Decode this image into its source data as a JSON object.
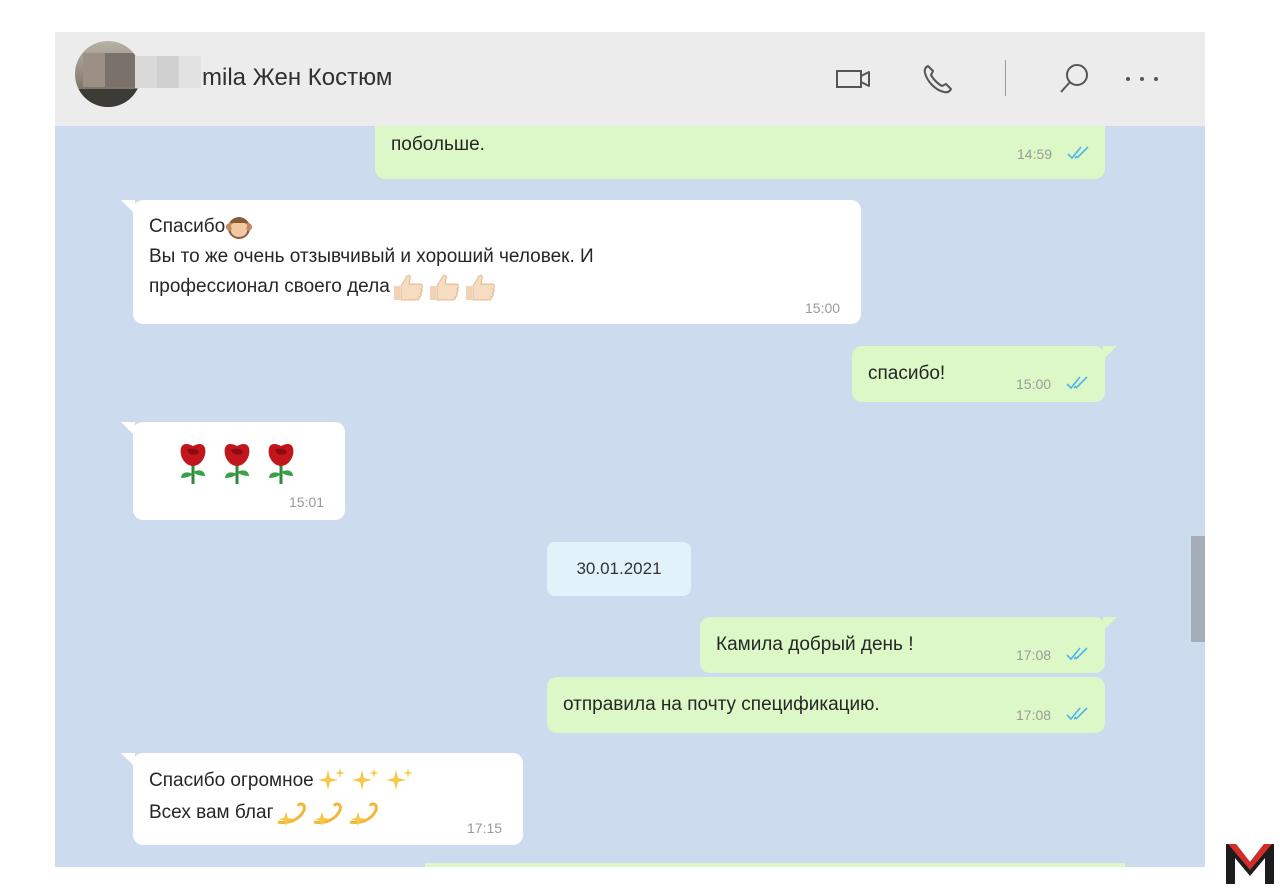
{
  "header": {
    "contact_name": "mila Жен Костюм",
    "icons": [
      "video-icon",
      "phone-icon",
      "search-icon",
      "more-icon"
    ]
  },
  "messages": [
    {
      "direction": "out",
      "text": "побольше.",
      "time": "14:59",
      "read": true
    },
    {
      "direction": "in",
      "line1": "Спасибо",
      "line2": "Вы то же очень отзывчивый и хороший человек. И",
      "line3": "профессионал своего дела",
      "time": "15:00"
    },
    {
      "direction": "out",
      "text": "спасибо!",
      "time": "15:00",
      "read": true
    },
    {
      "direction": "in",
      "text": "",
      "emoji": "roses",
      "time": "15:01"
    },
    {
      "direction": "out",
      "text": "Камила добрый день !",
      "time": "17:08",
      "read": true
    },
    {
      "direction": "out",
      "text": "отправила на почту спецификацию.",
      "time": "17:08",
      "read": true
    },
    {
      "direction": "in",
      "line1": "Спасибо огромное",
      "line2": "Всех вам благ",
      "time": "17:15"
    }
  ],
  "date_separator": "30.01.2021",
  "colors": {
    "chat_bg": "#ccdbee",
    "incoming": "#ffffff",
    "outgoing": "#dcf8c6",
    "read_ticks": "#4fb6ec",
    "logo_red": "#d42b2b",
    "logo_dark": "#1c1c1c"
  }
}
